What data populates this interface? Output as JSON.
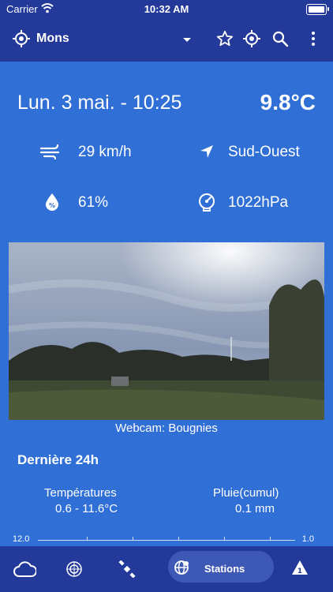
{
  "status_bar": {
    "carrier": "Carrier",
    "time": "10:32 AM"
  },
  "toolbar": {
    "city": "Mons"
  },
  "weather": {
    "date": "Lun.  3 mai. - 10:25",
    "temperature": "9.8°C",
    "wind_speed": "29 km/h",
    "wind_direction": "Sud-Ouest",
    "humidity": "61%",
    "pressure": "1022hPa"
  },
  "webcam": {
    "caption": "Webcam: Bougnies"
  },
  "last24h": {
    "title": "Dernière 24h",
    "temperatures_label": "Températures",
    "temperatures_value": "0.6 - 11.6°C",
    "rain_label": "Pluie(cumul)",
    "rain_value": "0.1 mm",
    "axis_left": "12.0",
    "axis_right": "1.0"
  },
  "bottom_nav": {
    "active_label": "Stations",
    "badge": "1"
  },
  "icons": {
    "toolbar": [
      "location-target-icon",
      "chevron-down-icon",
      "star-icon",
      "gps-icon",
      "search-icon",
      "more-vertical-icon"
    ],
    "metrics": [
      "wind-icon",
      "direction-arrow-icon",
      "humidity-drop-icon",
      "pressure-gauge-icon"
    ],
    "nav": [
      "cloud-icon",
      "radar-icon",
      "satellite-icon",
      "globe-stations-icon",
      "alert-icon"
    ]
  },
  "colors": {
    "background": "#2f6fd6",
    "bars": "#233a9a",
    "active_tab": "#3e58b5"
  }
}
